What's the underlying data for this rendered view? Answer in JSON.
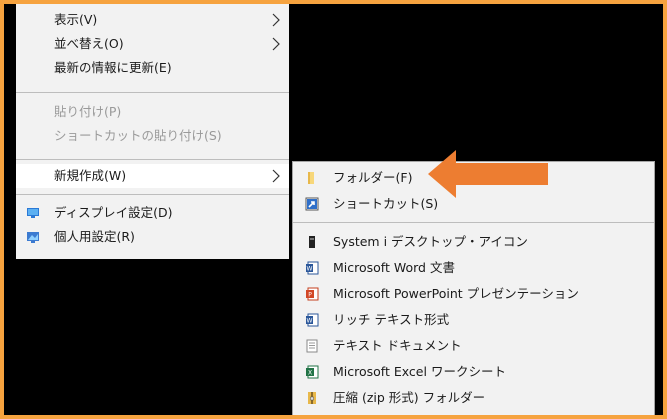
{
  "context_menu": {
    "items": [
      {
        "label": "表示(V)",
        "submenu": true,
        "disabled": false
      },
      {
        "label": "並べ替え(O)",
        "submenu": true,
        "disabled": false
      },
      {
        "label": "最新の情報に更新(E)",
        "submenu": false,
        "disabled": false
      },
      {
        "label": "貼り付け(P)",
        "submenu": false,
        "disabled": true
      },
      {
        "label": "ショートカットの貼り付け(S)",
        "submenu": false,
        "disabled": true
      },
      {
        "label": "新規作成(W)",
        "submenu": true,
        "disabled": false,
        "highlighted": true
      },
      {
        "label": "ディスプレイ設定(D)",
        "icon": "display-settings-icon",
        "disabled": false
      },
      {
        "label": "個人用設定(R)",
        "icon": "personalize-icon",
        "disabled": false
      }
    ]
  },
  "new_submenu": {
    "items": [
      {
        "label": "フォルダー(F)",
        "icon": "folder-icon"
      },
      {
        "label": "ショートカット(S)",
        "icon": "shortcut-icon"
      },
      {
        "label": "System i デスクトップ・アイコン",
        "icon": "system-i-icon"
      },
      {
        "label": "Microsoft Word 文書",
        "icon": "word-icon"
      },
      {
        "label": "Microsoft PowerPoint プレゼンテーション",
        "icon": "powerpoint-icon"
      },
      {
        "label": "リッチ テキスト形式",
        "icon": "rich-text-icon"
      },
      {
        "label": "テキスト ドキュメント",
        "icon": "text-document-icon"
      },
      {
        "label": "Microsoft Excel ワークシート",
        "icon": "excel-icon"
      },
      {
        "label": "圧縮 (zip 形式) フォルダー",
        "icon": "zip-folder-icon"
      }
    ]
  },
  "colors": {
    "frame_border": "#f6a33f",
    "annotation_arrow": "#ed7d31",
    "menu_bg": "#f2f2f2",
    "disabled_text": "#9a9a9a"
  }
}
